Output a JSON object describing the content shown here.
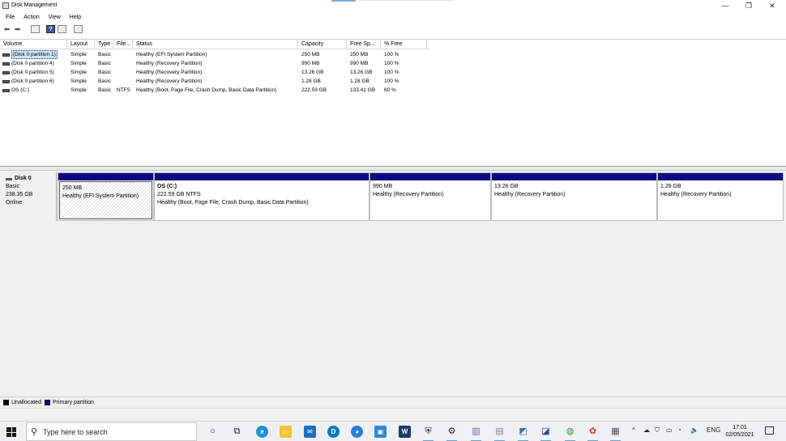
{
  "window": {
    "title": "Disk Management",
    "controls": {
      "minimize": "—",
      "maximize": "❐",
      "close": "✕"
    }
  },
  "menu": [
    "File",
    "Action",
    "View",
    "Help"
  ],
  "toolbar": {
    "back": "⬅",
    "forward": "➡",
    "help": "?"
  },
  "volume_table": {
    "columns": [
      "Volume",
      "Layout",
      "Type",
      "File...",
      "Status",
      "Capacity",
      "Free Sp...",
      "% Free"
    ],
    "rows": [
      {
        "volume": "(Disk 0 partition 1)",
        "layout": "Simple",
        "type": "Basic",
        "fs": "",
        "status": "Healthy (EFI System Partition)",
        "capacity": "250 MB",
        "free": "250 MB",
        "pct": "100 %"
      },
      {
        "volume": "(Disk 0 partition 4)",
        "layout": "Simple",
        "type": "Basic",
        "fs": "",
        "status": "Healthy (Recovery Partition)",
        "capacity": "990 MB",
        "free": "990 MB",
        "pct": "100 %"
      },
      {
        "volume": "(Disk 0 partition 5)",
        "layout": "Simple",
        "type": "Basic",
        "fs": "",
        "status": "Healthy (Recovery Partition)",
        "capacity": "13.26 GB",
        "free": "13.26 GB",
        "pct": "100 %"
      },
      {
        "volume": "(Disk 0 partition 6)",
        "layout": "Simple",
        "type": "Basic",
        "fs": "",
        "status": "Healthy (Recovery Partition)",
        "capacity": "1.28 GB",
        "free": "1.28 GB",
        "pct": "100 %"
      },
      {
        "volume": "OS (C:)",
        "layout": "Simple",
        "type": "Basic",
        "fs": "NTFS",
        "status": "Healthy (Boot, Page File, Crash Dump, Basic Data Partition)",
        "capacity": "222.59 GB",
        "free": "133.41 GB",
        "pct": "60 %"
      }
    ]
  },
  "disk": {
    "name": "Disk 0",
    "type": "Basic",
    "size": "238.35 GB",
    "state": "Online",
    "partitions": [
      {
        "name": "",
        "size": "250 MB",
        "status": "Healthy (EFI System Partition)"
      },
      {
        "name": "OS  (C:)",
        "size": "222.59 GB NTFS",
        "status": "Healthy (Boot, Page File, Crash Dump, Basic Data Partition)"
      },
      {
        "name": "",
        "size": "990 MB",
        "status": "Healthy (Recovery Partition)"
      },
      {
        "name": "",
        "size": "13.26 GB",
        "status": "Healthy (Recovery Partition)"
      },
      {
        "name": "",
        "size": "1.28 GB",
        "status": "Healthy (Recovery Partition)"
      }
    ]
  },
  "legend": {
    "unallocated": "Unallocated",
    "primary": "Primary partition"
  },
  "colors": {
    "primary_partition": "#0a0a80",
    "selection": "#cce4f7"
  },
  "taskbar": {
    "search_placeholder": "Type here to search",
    "language": "ENG",
    "time": "17:01",
    "date": "02/05/2021",
    "pinned_icons": [
      "cortana-icon",
      "task-view-icon",
      "edge-icon",
      "file-explorer-icon",
      "mail-icon",
      "dell-icon",
      "app-icon",
      "store-icon",
      "word-icon",
      "security-icon",
      "settings-icon",
      "app-icon",
      "app-icon",
      "app-icon",
      "app-icon",
      "app-icon",
      "app-icon",
      "app-icon"
    ]
  }
}
